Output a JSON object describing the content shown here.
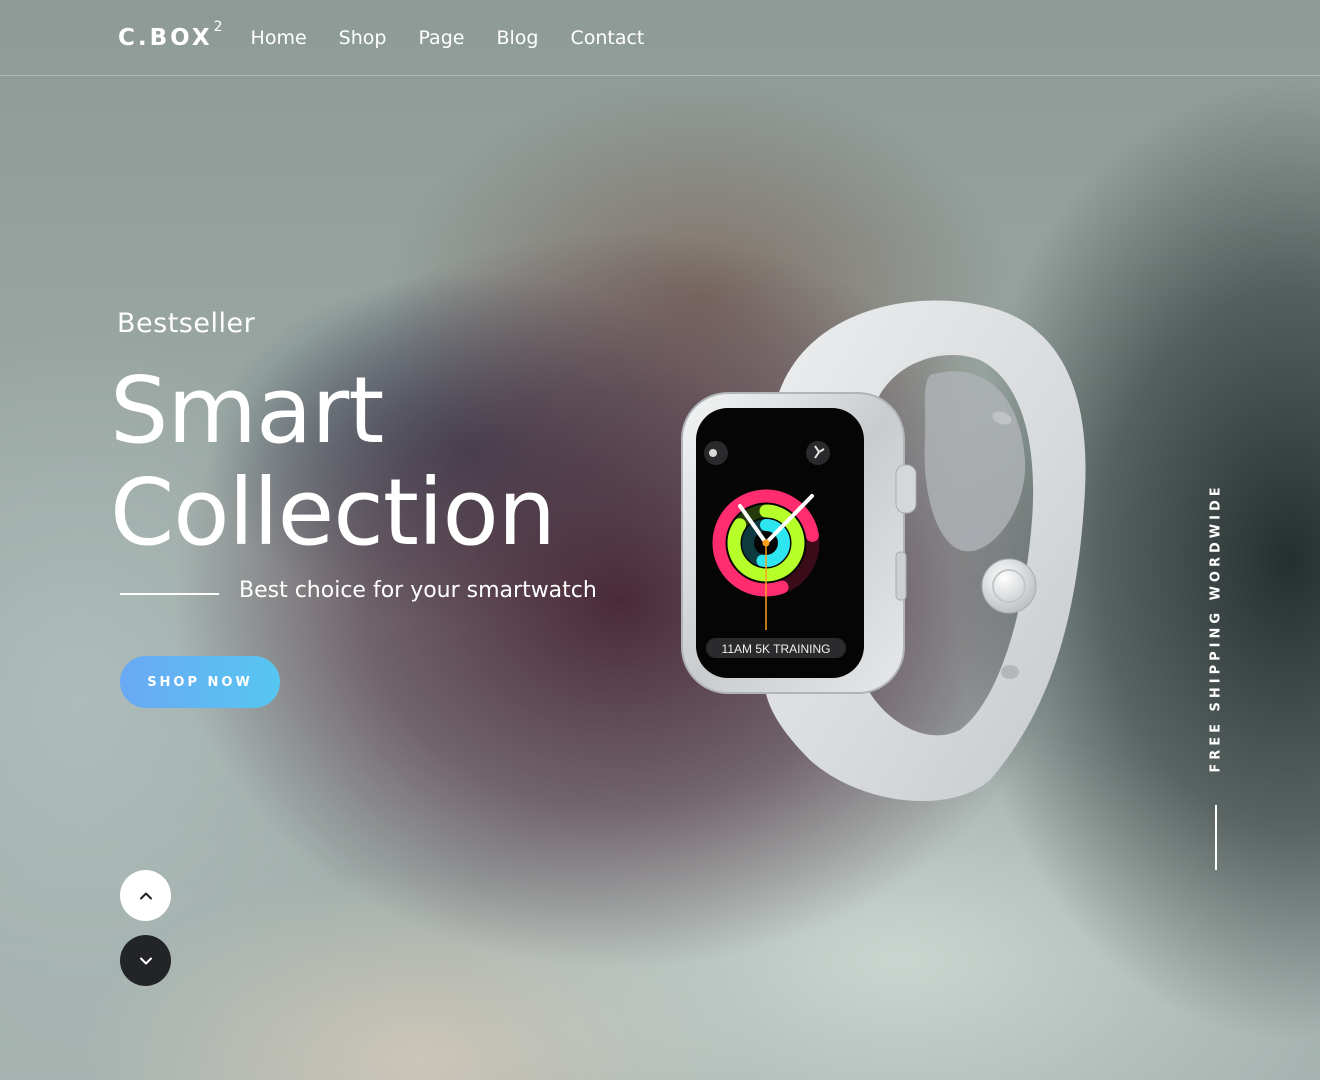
{
  "brand": {
    "name": "C.BOX",
    "superscript": "2"
  },
  "nav": {
    "items": [
      {
        "label": "Home"
      },
      {
        "label": "Shop"
      },
      {
        "label": "Page"
      },
      {
        "label": "Blog"
      },
      {
        "label": "Contact"
      }
    ]
  },
  "hero": {
    "eyebrow": "Bestseller",
    "title_line1": "Smart",
    "title_line2": "Collection",
    "tagline": "Best choice for your smartwatch",
    "cta_label": "SHOP NOW"
  },
  "watch": {
    "screen_label": "11AM 5K TRAINING"
  },
  "side": {
    "text": "FREE SHIPPING WORDWIDE"
  },
  "icons": {
    "up": "chevron-up-icon",
    "down": "chevron-down-icon"
  },
  "colors": {
    "cta_start": "#6aa9f3",
    "cta_end": "#56c6f2",
    "dark_button": "#222428",
    "ring_move": "#ff2d6f",
    "ring_exercise": "#b6ff28",
    "ring_stand": "#2ee6f0"
  }
}
